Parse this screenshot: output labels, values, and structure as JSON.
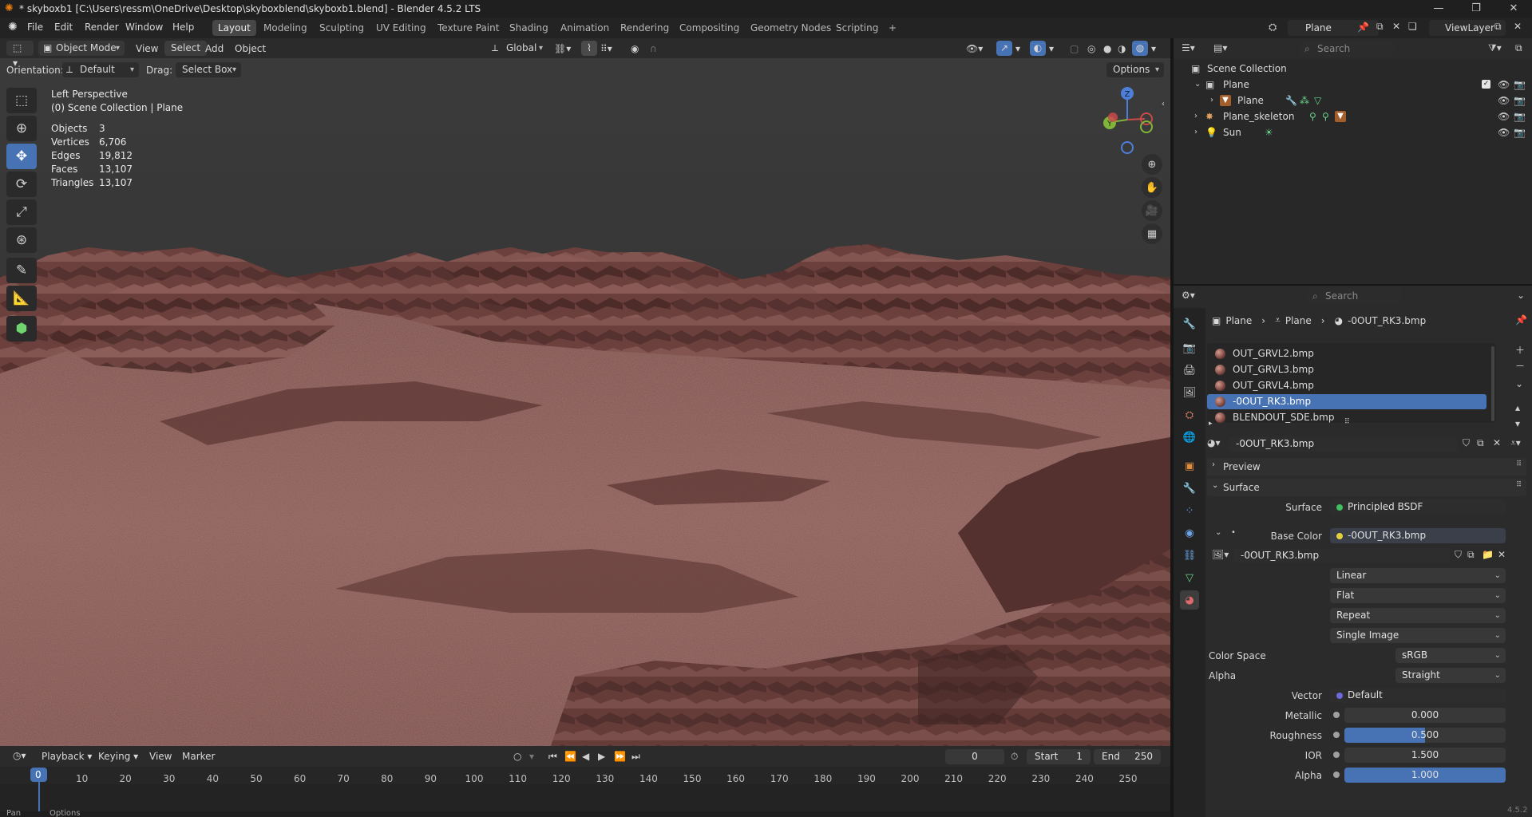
{
  "window": {
    "title": "* skyboxb1 [C:\\Users\\ressm\\OneDrive\\Desktop\\skyboxblend\\skyboxb1.blend] - Blender 4.5.2 LTS"
  },
  "menu": [
    "File",
    "Edit",
    "Render",
    "Window",
    "Help"
  ],
  "workspaces": [
    "Layout",
    "Modeling",
    "Sculpting",
    "UV Editing",
    "Texture Paint",
    "Shading",
    "Animation",
    "Rendering",
    "Compositing",
    "Geometry Nodes",
    "Scripting"
  ],
  "active_workspace": "Layout",
  "scene_name": "Plane",
  "viewlayer_name": "ViewLayer",
  "viewport": {
    "mode": "Object Mode",
    "menus": [
      "View",
      "Select",
      "Add",
      "Object"
    ],
    "transform_orientation": "Global",
    "orientation_label": "Orientation:",
    "orientation_value": "Default",
    "drag_label": "Drag:",
    "drag_value": "Select Box",
    "options_label": "Options",
    "view_name": "Left Perspective",
    "view_context": "(0) Scene Collection | Plane",
    "stats": [
      {
        "label": "Objects",
        "value": "3"
      },
      {
        "label": "Vertices",
        "value": "6,706"
      },
      {
        "label": "Edges",
        "value": "19,812"
      },
      {
        "label": "Faces",
        "value": "13,107"
      },
      {
        "label": "Triangles",
        "value": "13,107"
      }
    ],
    "gizmo_axes": {
      "z": "Z",
      "y": "Y"
    }
  },
  "timeline": {
    "menus": [
      "Playback",
      "Keying",
      "View",
      "Marker"
    ],
    "current_frame": "0",
    "start_label": "Start",
    "start": "1",
    "end_label": "End",
    "end": "250",
    "ticks": [
      "0",
      "10",
      "20",
      "30",
      "40",
      "50",
      "60",
      "70",
      "80",
      "90",
      "100",
      "110",
      "120",
      "130",
      "140",
      "150",
      "160",
      "170",
      "180",
      "190",
      "200",
      "210",
      "220",
      "230",
      "240",
      "250"
    ],
    "status_pan": "Pan",
    "status_options": "Options"
  },
  "outliner": {
    "search_placeholder": "Search",
    "root": "Scene Collection",
    "items": [
      {
        "name": "Plane",
        "level": 1
      },
      {
        "name": "Plane",
        "level": 2
      },
      {
        "name": "Plane_skeleton",
        "level": 1
      },
      {
        "name": "Sun",
        "level": 1
      }
    ]
  },
  "properties": {
    "search_placeholder": "Search",
    "breadcrumb": [
      "Plane",
      "Plane",
      "-0OUT_RK3.bmp"
    ],
    "materials": [
      "OUT_GRVL2.bmp",
      "OUT_GRVL3.bmp",
      "OUT_GRVL4.bmp",
      "-0OUT_RK3.bmp",
      "BLENDOUT_SDE.bmp"
    ],
    "selected_material_index": 3,
    "material_name": "-0OUT_RK3.bmp",
    "panel_preview": "Preview",
    "panel_surface": "Surface",
    "surface_label": "Surface",
    "surface_value": "Principled BSDF",
    "base_color_label": "Base Color",
    "base_color_value": "-0OUT_RK3.bmp",
    "image_name": "-0OUT_RK3.bmp",
    "interpolation": "Linear",
    "projection": "Flat",
    "extension": "Repeat",
    "source": "Single Image",
    "color_space_label": "Color Space",
    "color_space": "sRGB",
    "alpha_mode_label": "Alpha",
    "alpha_mode": "Straight",
    "vector_label": "Vector",
    "vector_value": "Default",
    "metallic_label": "Metallic",
    "metallic": "0.000",
    "roughness_label": "Roughness",
    "roughness": "0.500",
    "roughness_fraction": 0.5,
    "ior_label": "IOR",
    "ior": "1.500",
    "alpha_label": "Alpha",
    "alpha": "1.000",
    "alpha_fraction": 1.0
  },
  "version": "4.5.2",
  "colors": {
    "accent": "#4772b3",
    "header": "#2b2b2b",
    "panel": "#282828"
  }
}
